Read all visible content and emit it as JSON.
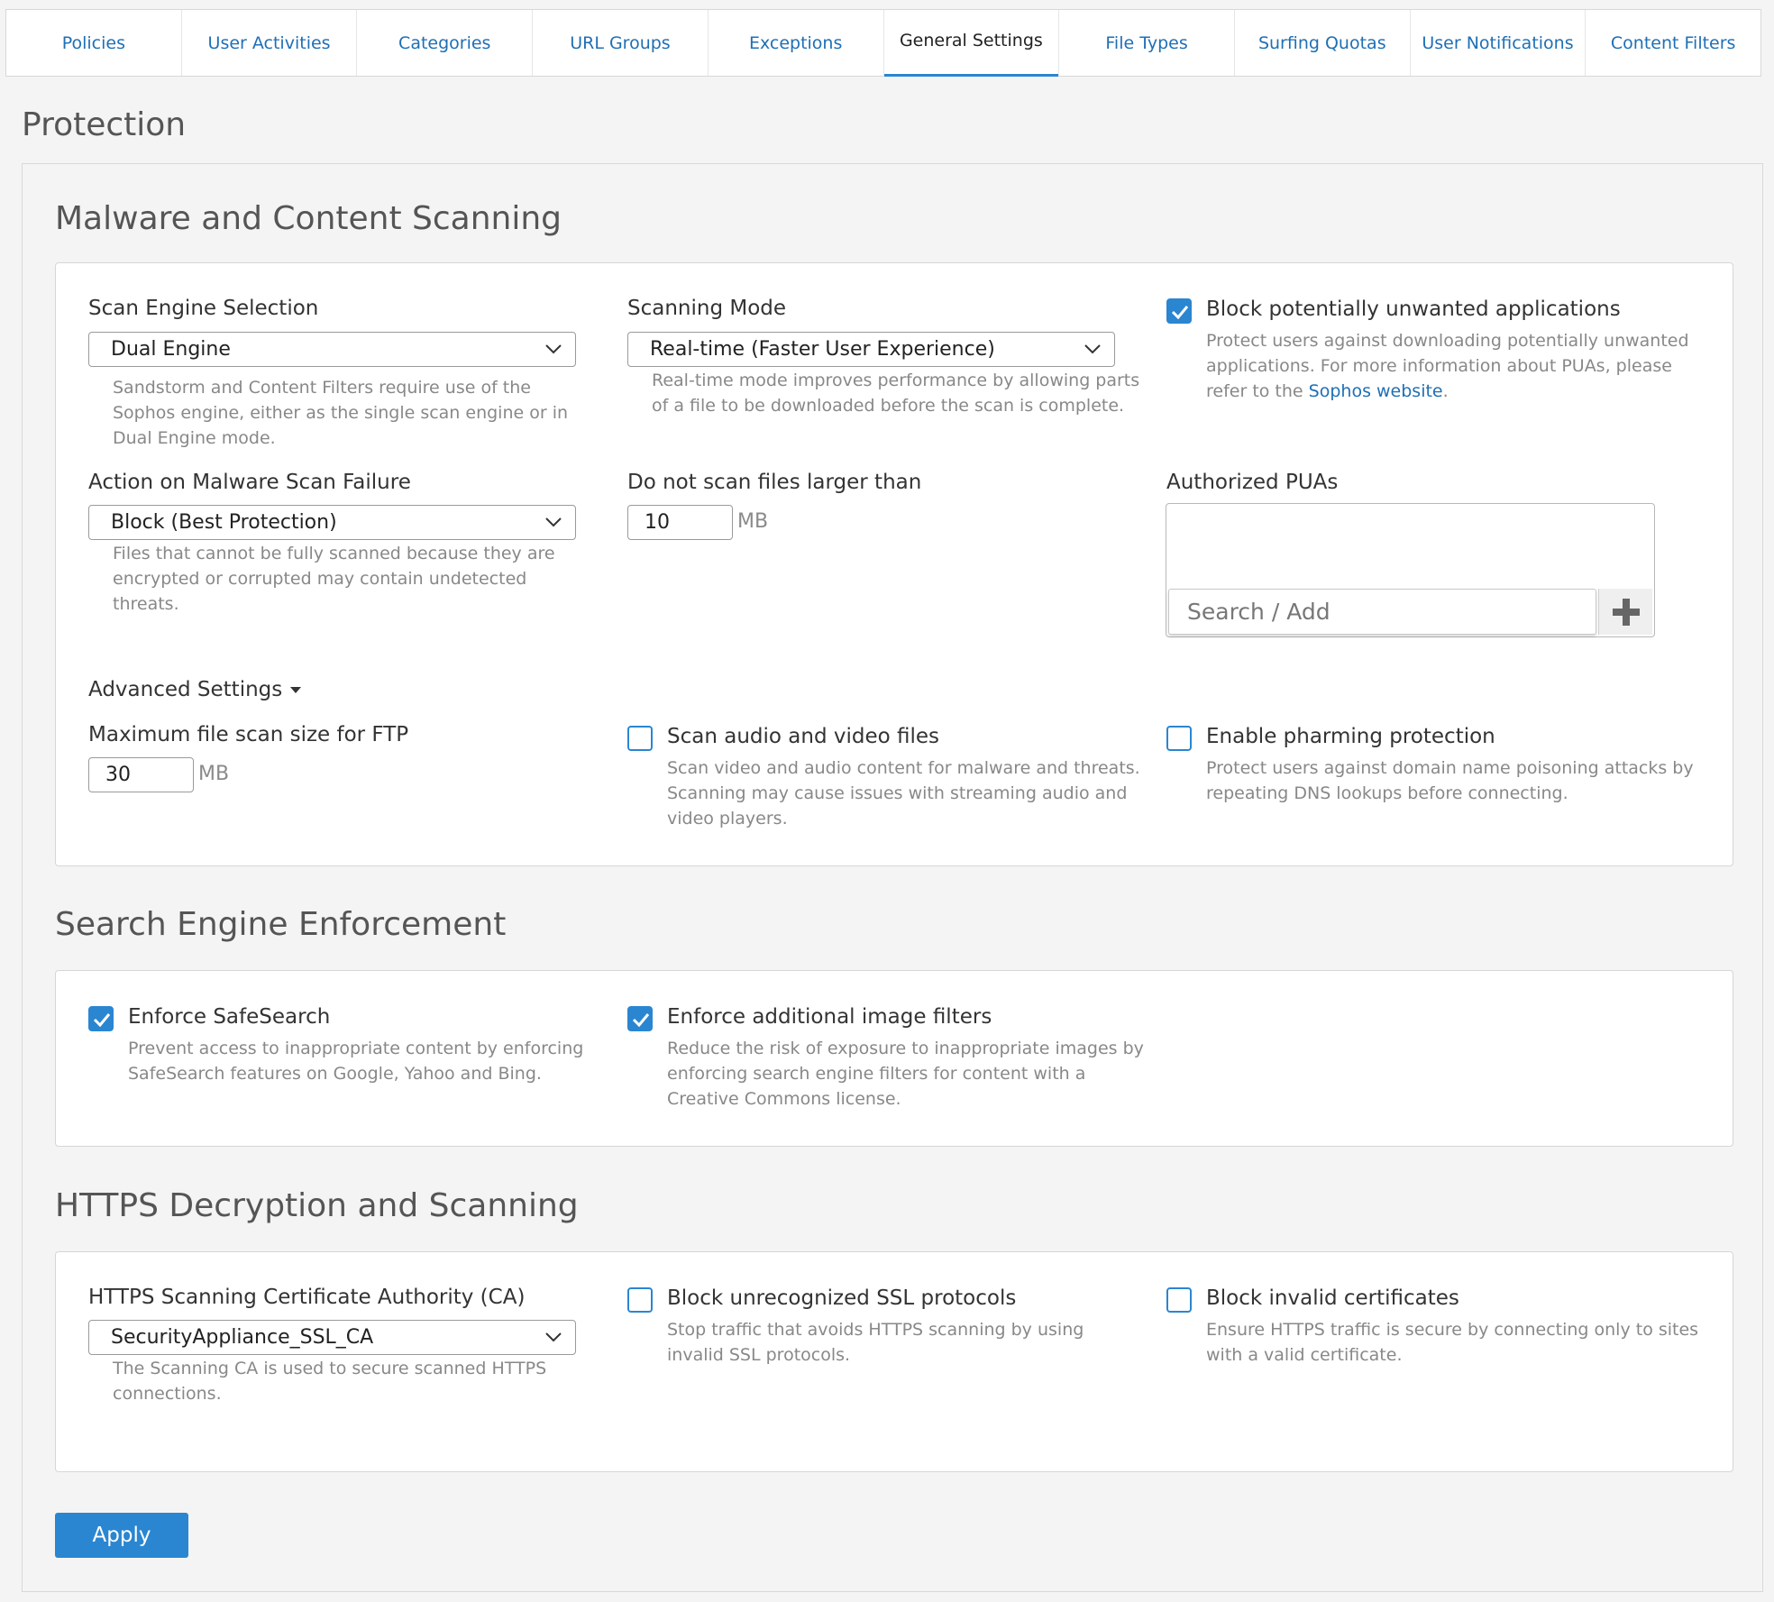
{
  "tabs": [
    {
      "label": "Policies"
    },
    {
      "label": "User Activities"
    },
    {
      "label": "Categories"
    },
    {
      "label": "URL Groups"
    },
    {
      "label": "Exceptions"
    },
    {
      "label": "General Settings",
      "active": true
    },
    {
      "label": "File Types"
    },
    {
      "label": "Surfing Quotas"
    },
    {
      "label": "User Notifications"
    },
    {
      "label": "Content Filters"
    }
  ],
  "page_title": "Protection",
  "malware": {
    "title": "Malware and Content Scanning",
    "scan_engine": {
      "label": "Scan Engine Selection",
      "value": "Dual Engine",
      "help": "Sandstorm and Content Filters require use of the Sophos engine, either as the single scan engine or in Dual Engine mode."
    },
    "scanning_mode": {
      "label": "Scanning Mode",
      "value": "Real-time (Faster User Experience)",
      "help": "Real-time mode improves performance by allowing parts of a file to be downloaded before the scan is complete."
    },
    "block_pua": {
      "label": "Block potentially unwanted applications",
      "checked": true,
      "help_prefix": "Protect users against downloading potentially unwanted applications. For more information about PUAs, please refer to the ",
      "help_link": "Sophos website",
      "help_suffix": "."
    },
    "scan_failure": {
      "label": "Action on Malware Scan Failure",
      "value": "Block (Best Protection)",
      "help": "Files that cannot be fully scanned because they are encrypted or corrupted may contain undetected threats."
    },
    "max_size": {
      "label": "Do not scan files larger than",
      "value": "10",
      "unit": "MB"
    },
    "authorized_puas": {
      "label": "Authorized PUAs",
      "placeholder": "Search / Add"
    },
    "advanced_label": "Advanced Settings",
    "ftp_size": {
      "label": "Maximum file scan size for FTP",
      "value": "30",
      "unit": "MB"
    },
    "scan_av": {
      "label": "Scan audio and video files",
      "checked": false,
      "help": "Scan video and audio content for malware and threats. Scanning may cause issues with streaming audio and video players."
    },
    "pharming": {
      "label": "Enable pharming protection",
      "checked": false,
      "help": "Protect users against domain name poisoning attacks by repeating DNS lookups before connecting."
    }
  },
  "search_engine": {
    "title": "Search Engine Enforcement",
    "safesearch": {
      "label": "Enforce SafeSearch",
      "checked": true,
      "help": "Prevent access to inappropriate content by enforcing SafeSearch features on Google, Yahoo and Bing."
    },
    "image_filters": {
      "label": "Enforce additional image filters",
      "checked": true,
      "help": "Reduce the risk of exposure to inappropriate images by enforcing search engine filters for content with a Creative Commons license."
    }
  },
  "https": {
    "title": "HTTPS Decryption and Scanning",
    "ca": {
      "label": "HTTPS Scanning Certificate Authority (CA)",
      "value": "SecurityAppliance_SSL_CA",
      "help": "The Scanning CA is used to secure scanned HTTPS connections."
    },
    "block_ssl": {
      "label": "Block unrecognized SSL protocols",
      "checked": false,
      "help": "Stop traffic that avoids HTTPS scanning by using invalid SSL protocols."
    },
    "block_invalid": {
      "label": "Block invalid certificates",
      "checked": false,
      "help": "Ensure HTTPS traffic is secure by connecting only to sites with a valid certificate."
    }
  },
  "apply_label": "Apply",
  "colors": {
    "accent": "#2a86d1",
    "link": "#1f6fb5"
  }
}
